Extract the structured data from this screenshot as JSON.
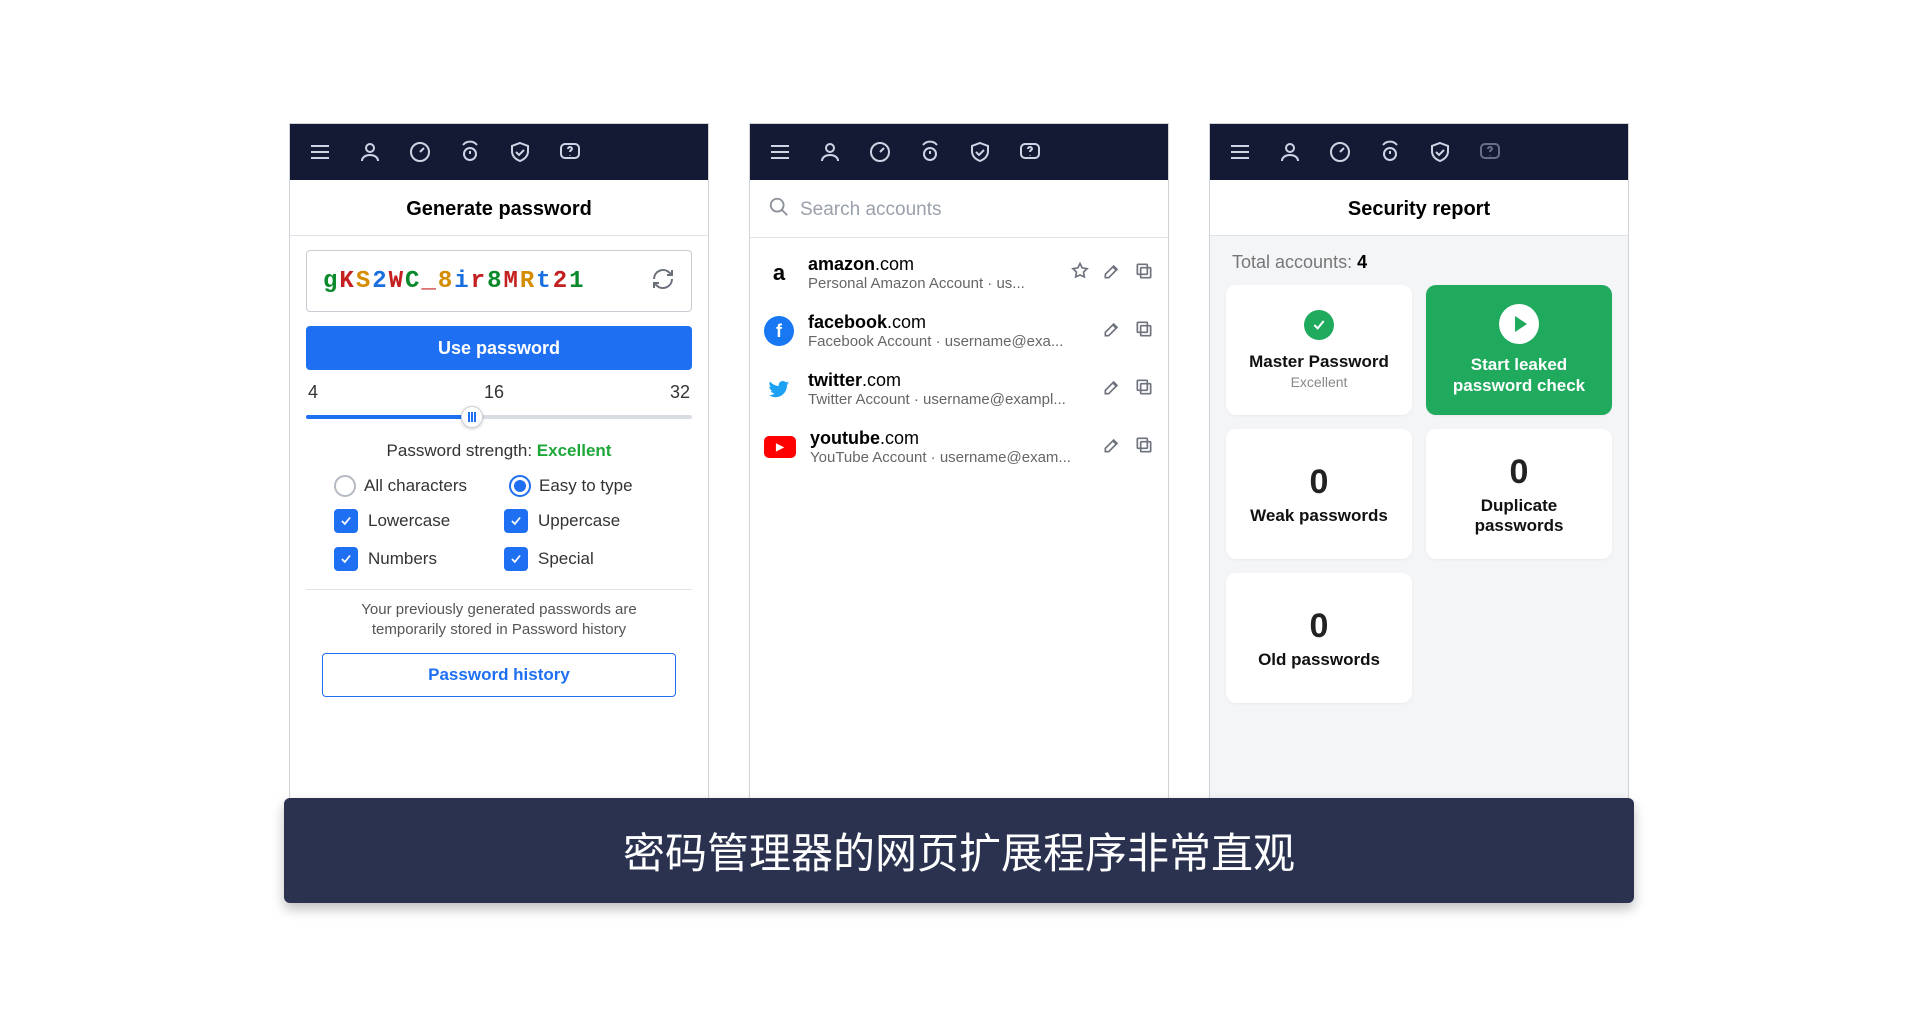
{
  "topbar_icons": [
    "menu",
    "user",
    "gauge",
    "timer",
    "shield",
    "help"
  ],
  "panel1": {
    "title": "Generate password",
    "password": "gKS2WC_8ir8MRt21",
    "use_button": "Use password",
    "slider": {
      "min": "4",
      "mid": "16",
      "max": "32",
      "value": 16
    },
    "strength_label": "Password strength: ",
    "strength_value": "Excellent",
    "radios": {
      "all": "All characters",
      "easy": "Easy to type"
    },
    "checks": {
      "lower": "Lowercase",
      "upper": "Uppercase",
      "numbers": "Numbers",
      "special": "Special"
    },
    "history_note": "Your previously generated passwords are temporarily stored in Password history",
    "history_button": "Password history"
  },
  "panel2": {
    "search_placeholder": "Search accounts",
    "accounts": [
      {
        "icon": "amazon",
        "domain_bold": "amazon",
        "domain_rest": ".com",
        "sub": "Personal Amazon Account · us...",
        "star": true
      },
      {
        "icon": "facebook",
        "domain_bold": "facebook",
        "domain_rest": ".com",
        "sub": "Facebook Account · username@exa...",
        "star": false
      },
      {
        "icon": "twitter",
        "domain_bold": "twitter",
        "domain_rest": ".com",
        "sub": "Twitter Account · username@exampl...",
        "star": false
      },
      {
        "icon": "youtube",
        "domain_bold": "youtube",
        "domain_rest": ".com",
        "sub": "YouTube Account · username@exam...",
        "star": false
      }
    ]
  },
  "panel3": {
    "title": "Security report",
    "total_label": "Total accounts: ",
    "total_value": "4",
    "tiles": {
      "master": {
        "label": "Master Password",
        "sub": "Excellent"
      },
      "leaked": {
        "label": "Start leaked password check"
      },
      "weak": {
        "count": "0",
        "label": "Weak passwords"
      },
      "dup": {
        "count": "0",
        "label": "Duplicate passwords"
      },
      "old": {
        "count": "0",
        "label": "Old passwords"
      }
    }
  },
  "caption": "密码管理器的网页扩展程序非常直观"
}
